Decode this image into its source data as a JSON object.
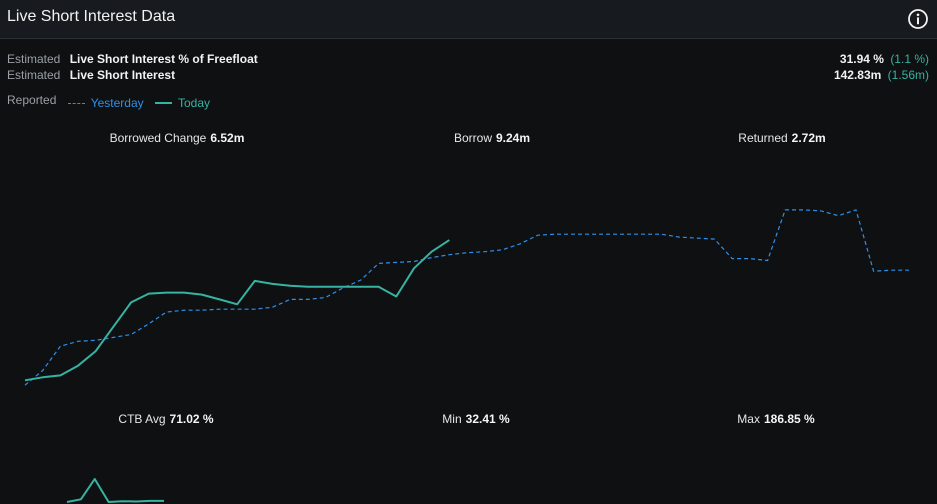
{
  "header": {
    "title": "Live Short Interest Data",
    "info_icon": "info-circle-icon"
  },
  "estimates": [
    {
      "prefix": "Estimated",
      "label": "Live Short Interest % of Freefloat",
      "value": "31.94 %",
      "change": "(1.1 %)"
    },
    {
      "prefix": "Estimated",
      "label": "Live Short Interest",
      "value": "142.83m",
      "change": "(1.56m)"
    }
  ],
  "legend": {
    "prefix": "Reported",
    "yesterday": "Yesterday",
    "today": "Today"
  },
  "stats_top": [
    {
      "label": "Borrowed Change",
      "value": "6.52m"
    },
    {
      "label": "Borrow",
      "value": "9.24m"
    },
    {
      "label": "Returned",
      "value": "2.72m"
    }
  ],
  "stats_bottom": [
    {
      "label": "CTB Avg",
      "value": "71.02 %"
    },
    {
      "label": "Min",
      "value": "32.41 %"
    },
    {
      "label": "Max",
      "value": "186.85 %"
    }
  ],
  "colors": {
    "yesterday": "#2f8fe8",
    "today": "#36b3a2",
    "change_text": "#36b3a2"
  },
  "chart_data": [
    {
      "type": "line",
      "series": [
        {
          "name": "Yesterday",
          "style": "dashed",
          "x": [
            0,
            1,
            2,
            3,
            4,
            5,
            6,
            7,
            8,
            9,
            10,
            11,
            12,
            13,
            14,
            15,
            16,
            17,
            18,
            19,
            20,
            21,
            22,
            23,
            24,
            25,
            26,
            27,
            28,
            29,
            30,
            31,
            32,
            33,
            34,
            35,
            36,
            37,
            38,
            39,
            40,
            41,
            42,
            43,
            44,
            45,
            46,
            47,
            48,
            49,
            50
          ],
          "values": [
            -0.5,
            1.0,
            3.5,
            4.0,
            4.1,
            4.4,
            4.7,
            5.8,
            7.0,
            7.2,
            7.2,
            7.3,
            7.3,
            7.3,
            7.5,
            8.3,
            8.3,
            8.5,
            9.5,
            10.3,
            12.0,
            12.1,
            12.2,
            12.6,
            12.9,
            13.1,
            13.2,
            13.4,
            14.0,
            14.9,
            15.0,
            15.0,
            15.0,
            15.0,
            15.0,
            15.0,
            15.0,
            14.7,
            14.6,
            14.5,
            12.5,
            12.5,
            12.3,
            17.5,
            17.5,
            17.4,
            16.9,
            17.5,
            11.2,
            11.3,
            11.3
          ]
        },
        {
          "name": "Today",
          "style": "solid",
          "x": [
            0,
            1,
            2,
            3,
            4,
            5,
            6,
            7,
            8,
            9,
            10,
            11,
            12,
            13,
            14,
            15,
            16,
            17,
            18,
            19,
            20,
            21,
            22,
            23,
            24
          ],
          "values": [
            0.0,
            0.3,
            0.5,
            1.5,
            3.0,
            5.5,
            8.0,
            8.9,
            9.0,
            9.0,
            8.8,
            8.3,
            7.8,
            10.2,
            9.9,
            9.7,
            9.6,
            9.6,
            9.6,
            9.6,
            9.6,
            8.6,
            11.5,
            13.2,
            14.4
          ]
        }
      ]
    },
    {
      "type": "line",
      "series": [
        {
          "name": "Today",
          "style": "solid",
          "x": [
            0,
            1,
            2,
            3,
            4,
            5,
            6,
            7
          ],
          "values": [
            100,
            110,
            186,
            100,
            103,
            102,
            104,
            104
          ]
        }
      ]
    }
  ]
}
